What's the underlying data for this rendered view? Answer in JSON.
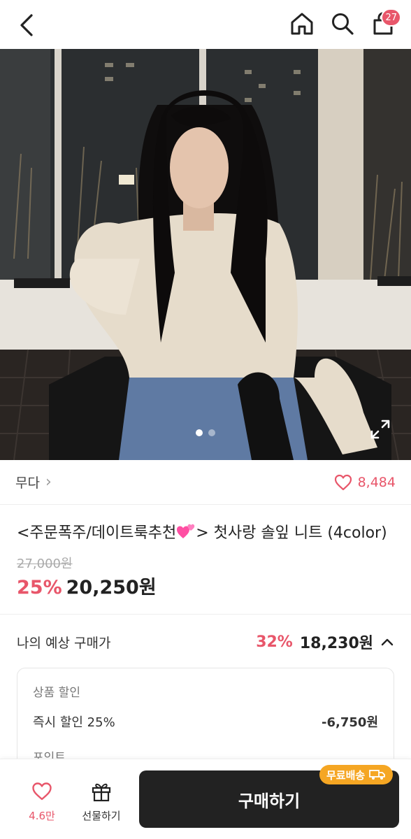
{
  "header": {
    "cart_count": "27",
    "icons": [
      "back-icon",
      "home-icon",
      "search-icon",
      "cart-icon"
    ]
  },
  "hero": {
    "image_index": 1,
    "image_total": 2,
    "expand_icon": "expand-icon"
  },
  "brand": {
    "name": "무다",
    "chevron": "›",
    "like_count": "8,484"
  },
  "product": {
    "title_prefix": "<주문폭주/데이트룩추천",
    "title_suffix": "> 첫사랑 솔잎 니트 (4color)",
    "original_price": "27,000원",
    "discount_pct": "25%",
    "sale_price": "20,250원"
  },
  "expected_price": {
    "label": "나의 예상 구매가",
    "discount_pct": "32%",
    "price": "18,230원"
  },
  "discount_detail": {
    "section_title": "상품 할인",
    "rows": [
      {
        "label": "즉시 할인 25%",
        "amount": "-6,750원"
      }
    ],
    "section2_title": "포인트"
  },
  "bottom_bar": {
    "like_label": "4.6만",
    "gift_label": "선물하기",
    "buy_label": "구매하기",
    "shipping_badge": "무료배송"
  },
  "colors": {
    "accent": "#e8566a",
    "dark": "#222222",
    "badge": "#f5a623"
  }
}
